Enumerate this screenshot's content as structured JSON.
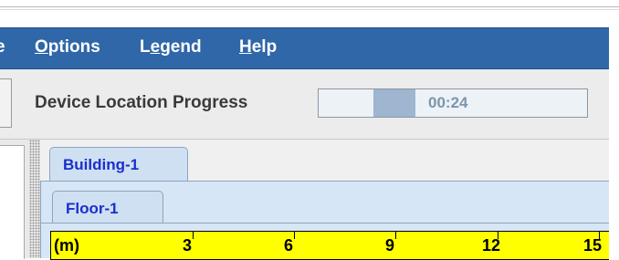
{
  "menubar": {
    "items": [
      {
        "label": "Options",
        "mnemonic": "O",
        "rest": "ptions"
      },
      {
        "label": "Legend",
        "pre": "L",
        "mnemonic": "e",
        "rest": "gend"
      },
      {
        "label": "Help",
        "mnemonic": "H",
        "rest": "elp"
      }
    ]
  },
  "toolbar": {
    "progress_label": "Device Location Progress",
    "progress_time": "00:24"
  },
  "tabs": {
    "building": "Building-1",
    "floor": "Floor-1"
  },
  "ruler": {
    "unit": "(m)",
    "ticks": [
      "3",
      "6",
      "9",
      "12",
      "15"
    ],
    "color": "#ffff00"
  }
}
